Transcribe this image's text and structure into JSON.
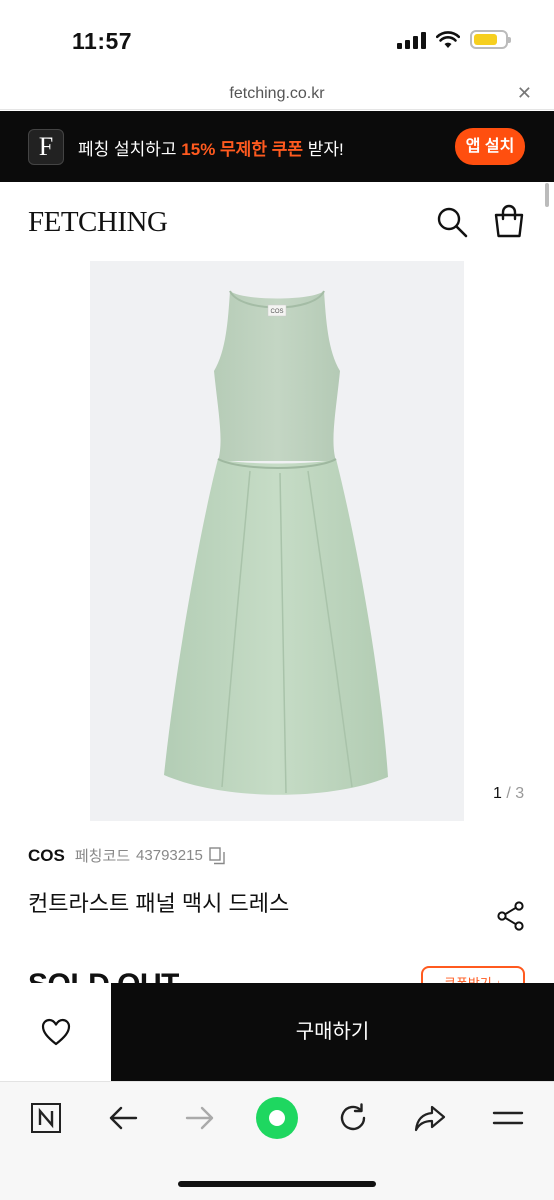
{
  "status_bar": {
    "time": "11:57",
    "battery_color": "#f6cf1f"
  },
  "url_bar": {
    "url": "fetching.co.kr",
    "close_glyph": "✕"
  },
  "app_banner": {
    "logo_letter": "F",
    "text_before": "페칭 설치하고 ",
    "text_highlight": "15% 무제한 쿠폰",
    "text_after": " 받자!",
    "install_label": "앱 설치",
    "accent_color": "#ff4f0f"
  },
  "header": {
    "logo": "FETCHING",
    "icons": [
      "search-icon",
      "shopping-bag-icon"
    ]
  },
  "gallery": {
    "current": "1",
    "separator": " / ",
    "total": "3",
    "garment_label": "COS"
  },
  "product": {
    "brand": "COS",
    "code_label": "페칭코드",
    "code_value": "43793215",
    "name": "컨트라스트 패널 맥시 드레스",
    "status": "SOLD OUT",
    "coupon_label": "쿠폰받기 ↓"
  },
  "purchase_bar": {
    "buy_label": "구매하기",
    "icons": [
      "heart-icon"
    ]
  },
  "browser_toolbar": {
    "icons": [
      "naver-n-icon",
      "back-arrow-icon",
      "forward-arrow-icon",
      "green-dot-icon",
      "reload-icon",
      "share-arrow-icon",
      "menu-icon"
    ]
  }
}
